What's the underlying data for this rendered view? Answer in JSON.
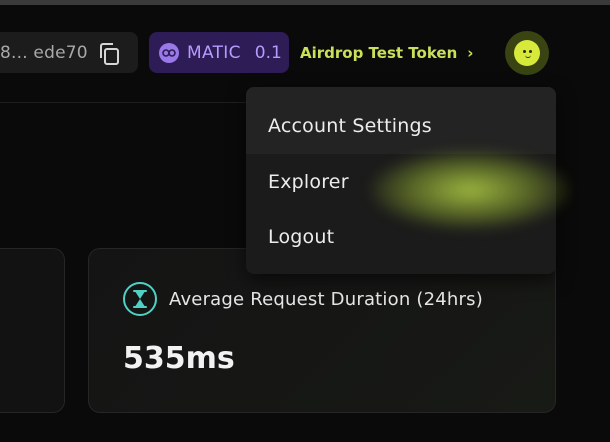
{
  "header": {
    "address": "8... ede70",
    "network": {
      "symbol": "MATIC",
      "amount": "0.1"
    },
    "airdrop_label": "Airdrop Test Token",
    "airdrop_chevron": "›"
  },
  "dropdown": {
    "items": [
      {
        "label": "Account Settings"
      },
      {
        "label": "Explorer"
      },
      {
        "label": "Logout"
      }
    ]
  },
  "stat_card": {
    "label": "Average Request Duration (24hrs)",
    "value": "535ms"
  },
  "icons": {
    "copy": "copy-icon",
    "matic": "polygon-icon",
    "avatar": "smiley-avatar-icon",
    "stat": "hourglass-icon"
  },
  "colors": {
    "accent_lime": "#c8e05a",
    "matic_purple": "#b69bff",
    "teal": "#4fd1c5",
    "background": "#0a0a0a"
  }
}
